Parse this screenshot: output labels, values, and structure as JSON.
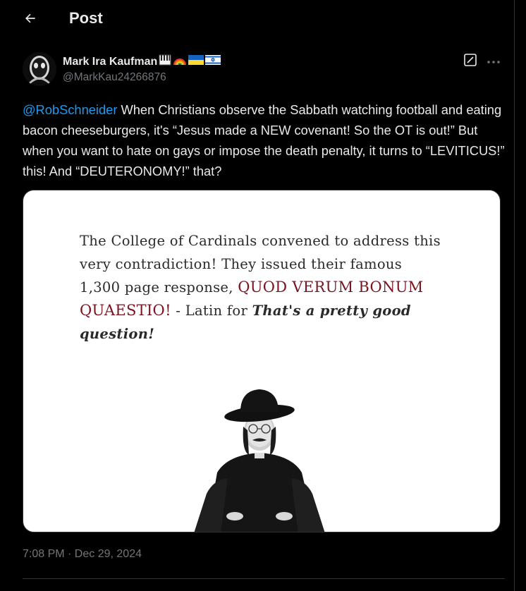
{
  "header": {
    "title": "Post"
  },
  "author": {
    "name": "Mark Ira Kaufman",
    "handle": "@MarkKau24266876",
    "emojis": [
      "piano-emoji",
      "rainbow-emoji",
      "ukraine-flag-emoji",
      "israel-flag-emoji"
    ]
  },
  "tweet": {
    "mention": "@RobSchneider",
    "body": " When Christians observe the Sabbath watching football and eating bacon cheeseburgers, it's “Jesus made a NEW covenant! So the OT is out!” But when you want to hate on gays or impose the death penalty, it turns to “LEVITICUS!” this! And “DEUTERONOMY!” that?",
    "timestamp": "7:08 PM · Dec 29, 2024"
  },
  "media": {
    "text_line1": "The College of Cardinals convened to address this very contradiction! They issued their famous 1,300 page response, ",
    "text_red": "QUOD VERUM BONUM QUAESTIO!",
    "text_mid": " - Latin for ",
    "text_italic": "That's a pretty good question!"
  },
  "colors": {
    "background": "#000000",
    "text": "#e7e9ea",
    "muted": "#71767b",
    "link": "#1d9bf0",
    "border": "#2f3336",
    "comic_red": "#7a1420"
  }
}
